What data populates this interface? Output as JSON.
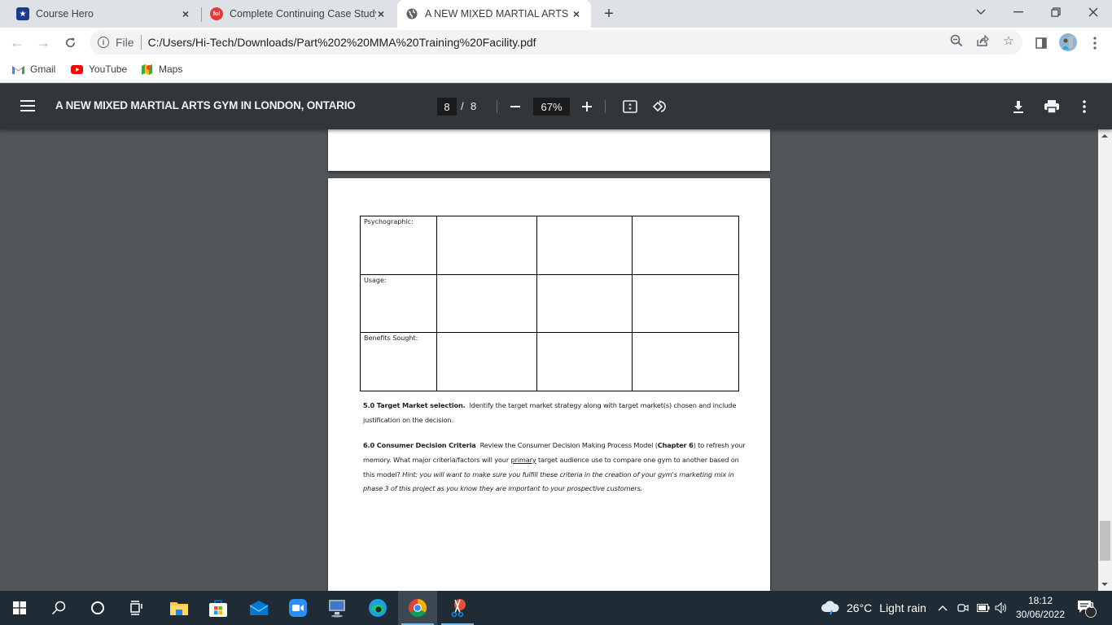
{
  "browser": {
    "tabs": [
      {
        "title": "Course Hero",
        "icon": "course-hero-shield-icon",
        "active": false
      },
      {
        "title": "Complete Continuing Case Study",
        "icon": "fol-icon",
        "active": false
      },
      {
        "title": "A NEW MIXED MARTIAL ARTS GY",
        "icon": "globe-icon",
        "active": true
      }
    ],
    "new_tab_label": "+",
    "address": {
      "scheme_label": "File",
      "url": "C:/Users/Hi-Tech/Downloads/Part%202%20MMA%20Training%20Facility.pdf"
    },
    "bookmarks": [
      {
        "label": "Gmail",
        "icon": "gmail-icon"
      },
      {
        "label": "YouTube",
        "icon": "youtube-icon"
      },
      {
        "label": "Maps",
        "icon": "maps-icon"
      }
    ]
  },
  "pdf_viewer": {
    "title": "A NEW MIXED MARTIAL ARTS GYM IN LONDON, ONTARIO",
    "current_page": "8",
    "page_separator": "/",
    "total_pages": "8",
    "zoom": "67%"
  },
  "document": {
    "table_rows": [
      {
        "label": "Psychographic:",
        "cells": [
          "",
          "",
          ""
        ]
      },
      {
        "label": "Usage:",
        "cells": [
          "",
          "",
          ""
        ]
      },
      {
        "label": "Benefits Sought:",
        "cells": [
          "",
          "",
          ""
        ]
      }
    ],
    "section5": {
      "heading": "5.0 Target Market selection.",
      "body": "Identify the target market strategy along with target market(s) chosen and include justification on the decision."
    },
    "section6": {
      "heading": "6.0 Consumer Decision Criteria",
      "body_1": "Review the Consumer Decision Making Process Model (",
      "chapter": "Chapter 6",
      "body_2": ") to refresh your memory.  What major criteria/factors will your ",
      "underlined": "primary",
      "body_3": " target audience use to compare one gym to another based on this model?",
      "hint": "Hint: you will want to make sure you fulfill these criteria in the creation of your gym's marketing mix in phase 3 of this project as you know they are important to your prospective customers."
    }
  },
  "taskbar": {
    "apps": [
      "start",
      "search",
      "cortana",
      "task-view",
      "file-explorer",
      "microsoft-store",
      "mail",
      "zoom",
      "remote-desktop",
      "edge",
      "chrome",
      "snipping-tool"
    ],
    "weather": {
      "temp": "26°C",
      "condition": "Light rain"
    },
    "time": "18:12",
    "date": "30/06/2022",
    "notification_count": "3"
  }
}
